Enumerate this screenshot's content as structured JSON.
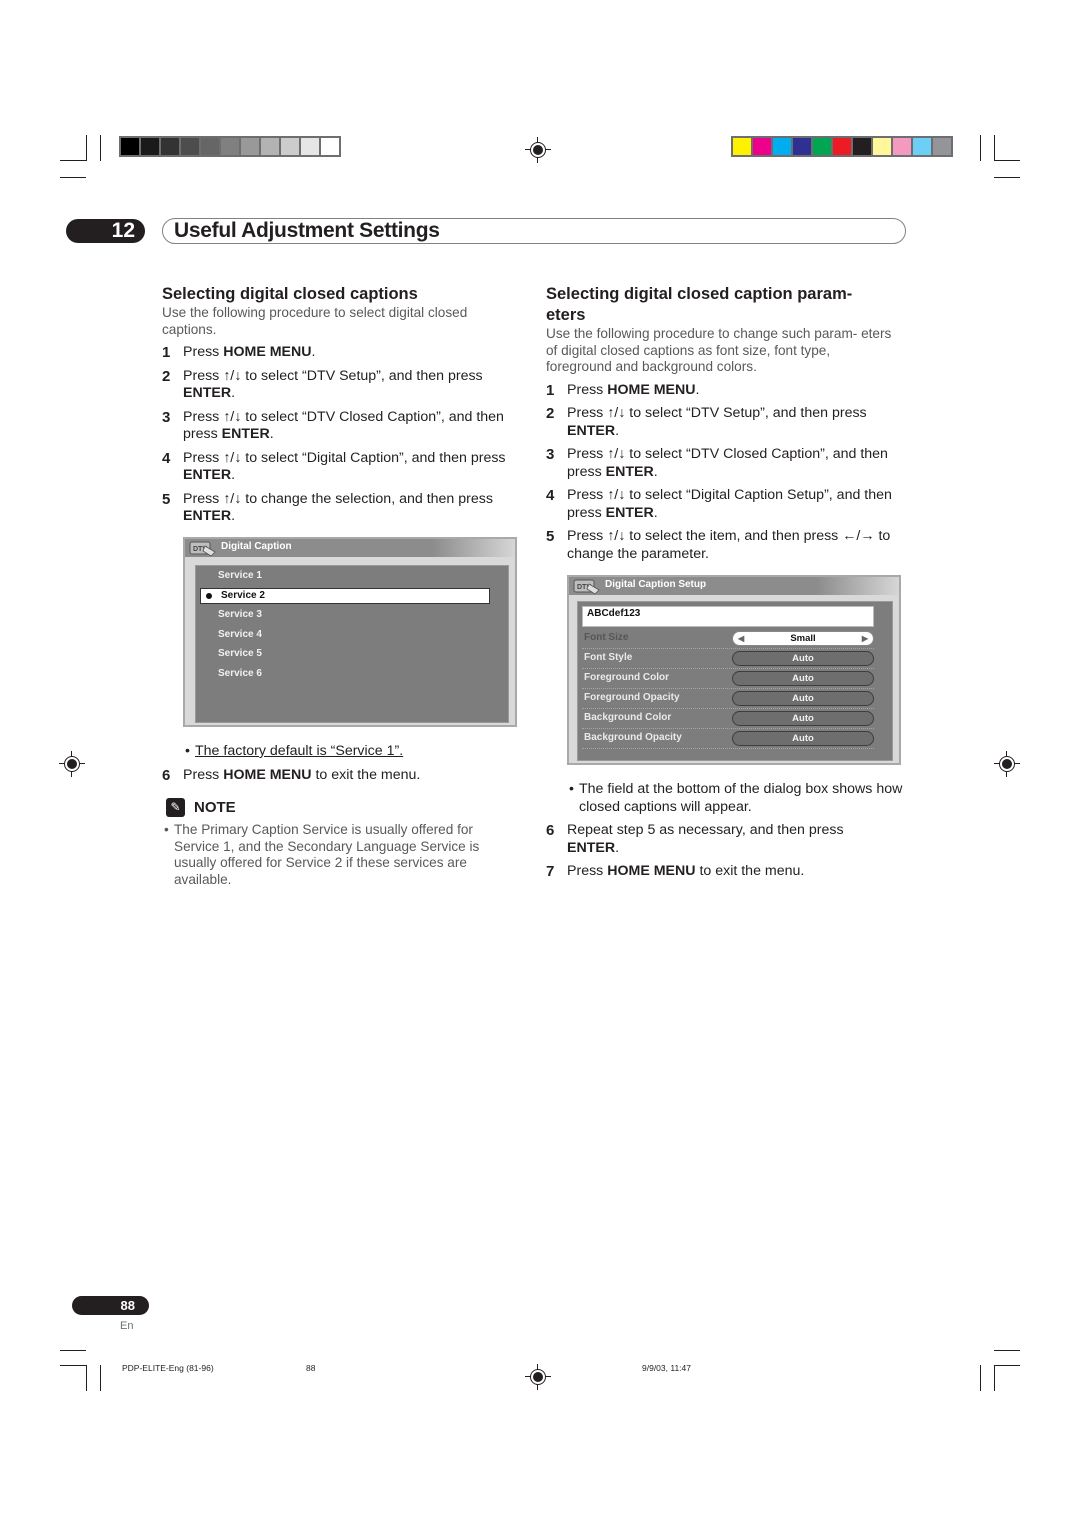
{
  "print_marks": {
    "grayscale_swatches": [
      "#000000",
      "#1a1a1a",
      "#333333",
      "#4d4d4d",
      "#666666",
      "#808080",
      "#999999",
      "#b3b3b3",
      "#cccccc",
      "#e6e6e6",
      "#ffffff"
    ],
    "color_swatches": [
      "#fff200",
      "#ec008c",
      "#00aeef",
      "#2e3192",
      "#00a651",
      "#ed1c24",
      "#231f20",
      "#fff799",
      "#f49ac1",
      "#6dcff6",
      "#939598"
    ]
  },
  "chapter": {
    "number": "12",
    "title": "Useful Adjustment Settings"
  },
  "left_section": {
    "heading": "Selecting digital closed captions",
    "intro": "Use the following procedure to select digital closed captions.",
    "steps": [
      {
        "num": "1",
        "pre": "Press ",
        "bold": "HOME MENU",
        "post": "."
      },
      {
        "num": "2",
        "pre": "Press ↑/↓ to select “DTV Setup”, and then press ",
        "bold": "ENTER",
        "post": "."
      },
      {
        "num": "3",
        "pre": "Press ↑/↓ to select “DTV Closed Caption”, and then press ",
        "bold": "ENTER",
        "post": "."
      },
      {
        "num": "4",
        "pre": "Press ↑/↓ to select “Digital Caption”, and then press ",
        "bold": "ENTER",
        "post": "."
      },
      {
        "num": "5",
        "pre": "Press ↑/↓ to change the selection, and then press ",
        "bold": "ENTER",
        "post": "."
      }
    ],
    "osd": {
      "title": "Digital Caption",
      "services": [
        "Service 1",
        "Service 2",
        "Service 3",
        "Service 4",
        "Service 5",
        "Service 6"
      ],
      "selected_index": 1
    },
    "bullet": "The factory default is “Service 1”.",
    "step6": {
      "num": "6",
      "pre": "Press ",
      "bold": "HOME MENU",
      "post": " to exit the menu."
    },
    "note": {
      "label": "NOTE",
      "text": "The Primary Caption Service is usually offered for Service 1, and the Secondary Language Service is usually offered for Service 2 if these services are available."
    }
  },
  "right_section": {
    "heading": "Selecting digital closed caption param- eters",
    "intro": "Use the following procedure to change such param- eters of digital closed captions as font size, font type, foreground and background colors.",
    "steps": [
      {
        "num": "1",
        "pre": "Press ",
        "bold": "HOME MENU",
        "post": "."
      },
      {
        "num": "2",
        "pre": "Press ↑/↓ to select “DTV Setup”, and then press ",
        "bold": "ENTER",
        "post": "."
      },
      {
        "num": "3",
        "pre": "Press ↑/↓ to select “DTV Closed Caption”, and then press ",
        "bold": "ENTER",
        "post": "."
      },
      {
        "num": "4",
        "pre": "Press ↑/↓ to select “Digital Caption Setup”, and then press ",
        "bold": "ENTER",
        "post": "."
      },
      {
        "num": "5",
        "pre": "Press ↑/↓ to select the item, and then press ←/→ to change the parameter.",
        "bold": "",
        "post": ""
      }
    ],
    "osd": {
      "title": "Digital Caption Setup",
      "preview": "ABCdef123",
      "params": [
        {
          "label": "Font Size",
          "value": "Small"
        },
        {
          "label": "Font Style",
          "value": "Auto"
        },
        {
          "label": "Foreground Color",
          "value": "Auto"
        },
        {
          "label": "Foreground Opacity",
          "value": "Auto"
        },
        {
          "label": "Background Color",
          "value": "Auto"
        },
        {
          "label": "Background Opacity",
          "value": "Auto"
        }
      ],
      "active_index": 0
    },
    "bullet": "The field at the bottom of the dialog box shows how closed captions will appear.",
    "step6": {
      "num": "6",
      "pre": "Repeat step 5 as necessary, and then press ",
      "bold": "ENTER",
      "post": "."
    },
    "step7": {
      "num": "7",
      "pre": "Press ",
      "bold": "HOME MENU",
      "post": " to exit the menu."
    }
  },
  "footer": {
    "page_number": "88",
    "language": "En",
    "file_name": "PDP-ELITE-Eng (81-96)",
    "file_page": "88",
    "timestamp": "9/9/03, 11:47"
  }
}
